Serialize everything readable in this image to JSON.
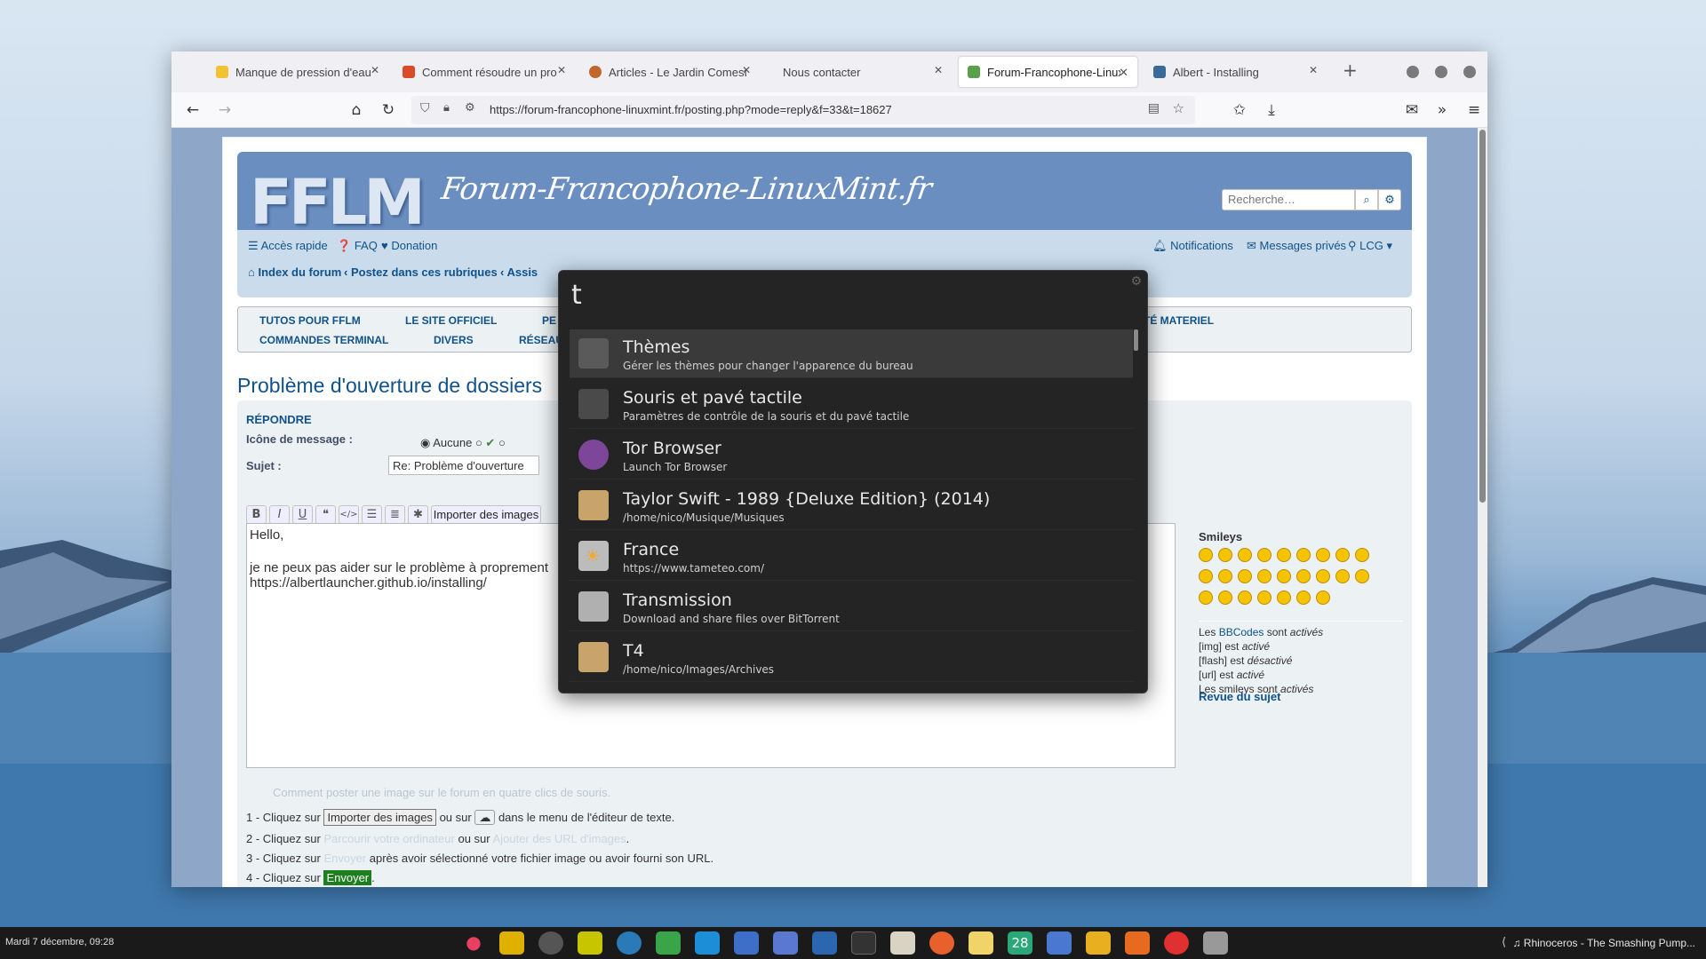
{
  "tabs": [
    {
      "label": "Manque de pression d'eau",
      "color": "#f1c232"
    },
    {
      "label": "Comment résoudre un pro",
      "color": "#d84a2a"
    },
    {
      "label": "Articles - Le Jardin Comestible",
      "color": "#c0672c"
    },
    {
      "label": "Nous contacter",
      "color": ""
    },
    {
      "label": "Forum-Francophone-LinuxMint",
      "color": "#5aa04a"
    },
    {
      "label": "Albert - Installing",
      "color": "#3a6a9a"
    }
  ],
  "url": "https://forum-francophone-linuxmint.fr/posting.php?mode=reply&f=33&t=18627",
  "site": {
    "logo": "FFLM",
    "name": "Forum-Francophone-LinuxMint.fr",
    "search_placeholder": "Recherche…"
  },
  "nav": {
    "quick": "Accès rapide",
    "faq": "FAQ",
    "donation": "Donation",
    "notifications": "Notifications",
    "messages": "Messages privés",
    "user": "LCG",
    "breadcrumb1": "Index du forum",
    "breadcrumb2": "Postez dans ces rubriques",
    "breadcrumb3": "Assis"
  },
  "categories": [
    "TUTOS POUR FFLM",
    "LE SITE OFFICIEL",
    "PE",
    "ILITÉ MATERIEL",
    "COMMANDES TERMINAL",
    "DIVERS",
    "RÉSEAU"
  ],
  "post": {
    "title": "Problème d'ouverture de dossiers",
    "section": "RÉPONDRE",
    "icon_label": "Icône de message :",
    "icon_none": "Aucune",
    "subject_label": "Sujet :",
    "subject_value": "Re: Problème d'ouverture",
    "import_btn": "Importer des images",
    "body_line1": "Hello,",
    "body_line2": "je ne peux pas aider sur le problème à proprement",
    "body_line3": "https://albertlauncher.github.io/installing/",
    "help_title": "Comment poster une image sur le forum en quatre clics de souris.",
    "step1a": "1 - Cliquez sur",
    "step1b": "ou sur",
    "step1c": "dans le menu de l'éditeur de texte.",
    "step2a": "2 - Cliquez sur",
    "step2b": "Parcourir votre ordinateur",
    "step2c": "ou sur",
    "step2d": "Ajouter des URL d'images",
    "step2e": ".",
    "step3a": "3 - Cliquez sur",
    "step3b": "Envoyer",
    "step3c": "après avoir sélectionné votre fichier image ou avoir fourni son URL.",
    "step4a": "4 - Cliquez sur",
    "step4b": "Envoyer",
    "step4c": "."
  },
  "sidebar": {
    "smileys": "Smileys",
    "bb1": "Les",
    "bb_link": "BBCodes",
    "bb2": "sont",
    "bb3": "activés",
    "img": "[img] est",
    "img_state": "activé",
    "flash": "[flash] est",
    "flash_state": "désactivé",
    "url": "[url] est",
    "url_state": "activé",
    "smiley_state_a": "Les smileys sont",
    "smiley_state_b": "activés",
    "review": "Revue du sujet"
  },
  "albert": {
    "query": "t",
    "items": [
      {
        "title": "Thèmes",
        "sub": "Gérer les thèmes pour changer l'apparence du bureau",
        "icon": "themes-icon",
        "color": "#6a6a6a"
      },
      {
        "title": "Souris et pavé tactile",
        "sub": "Paramètres de contrôle de la souris et du pavé tactile",
        "icon": "mouse-icon",
        "color": "#707070"
      },
      {
        "title": "Tor Browser",
        "sub": "Launch Tor Browser",
        "icon": "tor-icon",
        "color": "#7d4698"
      },
      {
        "title": "Taylor Swift - 1989 {Deluxe Edition} (2014)",
        "sub": "/home/nico/Musique/Musiques",
        "icon": "folder-icon",
        "color": "#c9a46a"
      },
      {
        "title": "France",
        "sub": "https://www.tameteo.com/",
        "icon": "weather-icon",
        "color": "#bcbcbc"
      },
      {
        "title": "Transmission",
        "sub": "Download and share files over BitTorrent",
        "icon": "transmission-icon",
        "color": "#b0b0b0"
      },
      {
        "title": "T4",
        "sub": "/home/nico/Images/Archives",
        "icon": "folder-icon",
        "color": "#c9a46a"
      }
    ]
  },
  "taskbar": {
    "clock": "Mardi  7 décembre, 09:28",
    "now_playing": "Rhinoceros - The Smashing Pump...",
    "calendar_day": "28"
  }
}
